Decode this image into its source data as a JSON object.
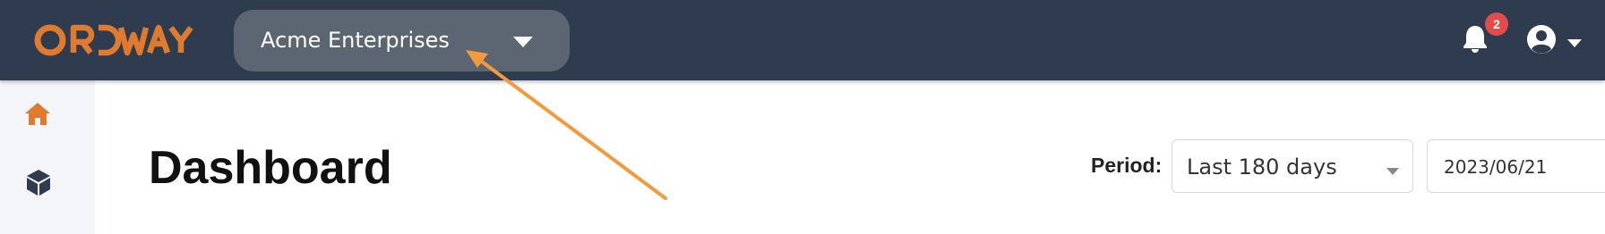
{
  "header": {
    "logo_text": "ORDWAY",
    "company_selector": {
      "value": "Acme Enterprises",
      "icon": "caret-down-icon"
    },
    "notifications": {
      "icon": "bell-icon",
      "count": "2"
    },
    "user_menu": {
      "icon": "user-circle-icon",
      "caret": "caret-down-icon"
    }
  },
  "sidebar": {
    "items": [
      {
        "icon": "home-icon",
        "active": true
      },
      {
        "icon": "cube-icon",
        "active": false
      }
    ]
  },
  "main": {
    "title": "Dashboard",
    "period_label": "Period:",
    "period_select": {
      "value": "Last 180 days"
    },
    "date_value": "2023/06/21"
  },
  "colors": {
    "header_bg": "#2f3c50",
    "brand_orange": "#e07a2f",
    "badge_red": "#e24c4b",
    "annotation_arrow": "#f39a3c"
  }
}
